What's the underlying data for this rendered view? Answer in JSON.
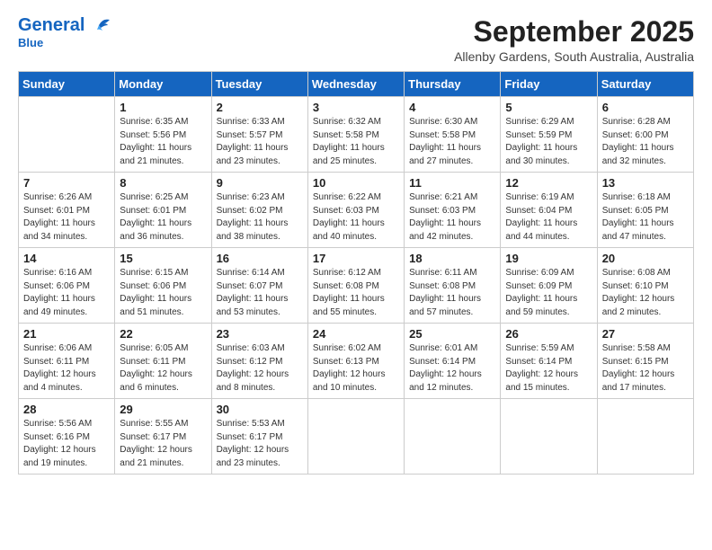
{
  "header": {
    "logo_general": "General",
    "logo_blue": "Blue",
    "month": "September 2025",
    "location": "Allenby Gardens, South Australia, Australia"
  },
  "weekdays": [
    "Sunday",
    "Monday",
    "Tuesday",
    "Wednesday",
    "Thursday",
    "Friday",
    "Saturday"
  ],
  "weeks": [
    [
      {
        "day": "",
        "info": ""
      },
      {
        "day": "1",
        "info": "Sunrise: 6:35 AM\nSunset: 5:56 PM\nDaylight: 11 hours\nand 21 minutes."
      },
      {
        "day": "2",
        "info": "Sunrise: 6:33 AM\nSunset: 5:57 PM\nDaylight: 11 hours\nand 23 minutes."
      },
      {
        "day": "3",
        "info": "Sunrise: 6:32 AM\nSunset: 5:58 PM\nDaylight: 11 hours\nand 25 minutes."
      },
      {
        "day": "4",
        "info": "Sunrise: 6:30 AM\nSunset: 5:58 PM\nDaylight: 11 hours\nand 27 minutes."
      },
      {
        "day": "5",
        "info": "Sunrise: 6:29 AM\nSunset: 5:59 PM\nDaylight: 11 hours\nand 30 minutes."
      },
      {
        "day": "6",
        "info": "Sunrise: 6:28 AM\nSunset: 6:00 PM\nDaylight: 11 hours\nand 32 minutes."
      }
    ],
    [
      {
        "day": "7",
        "info": "Sunrise: 6:26 AM\nSunset: 6:01 PM\nDaylight: 11 hours\nand 34 minutes."
      },
      {
        "day": "8",
        "info": "Sunrise: 6:25 AM\nSunset: 6:01 PM\nDaylight: 11 hours\nand 36 minutes."
      },
      {
        "day": "9",
        "info": "Sunrise: 6:23 AM\nSunset: 6:02 PM\nDaylight: 11 hours\nand 38 minutes."
      },
      {
        "day": "10",
        "info": "Sunrise: 6:22 AM\nSunset: 6:03 PM\nDaylight: 11 hours\nand 40 minutes."
      },
      {
        "day": "11",
        "info": "Sunrise: 6:21 AM\nSunset: 6:03 PM\nDaylight: 11 hours\nand 42 minutes."
      },
      {
        "day": "12",
        "info": "Sunrise: 6:19 AM\nSunset: 6:04 PM\nDaylight: 11 hours\nand 44 minutes."
      },
      {
        "day": "13",
        "info": "Sunrise: 6:18 AM\nSunset: 6:05 PM\nDaylight: 11 hours\nand 47 minutes."
      }
    ],
    [
      {
        "day": "14",
        "info": "Sunrise: 6:16 AM\nSunset: 6:06 PM\nDaylight: 11 hours\nand 49 minutes."
      },
      {
        "day": "15",
        "info": "Sunrise: 6:15 AM\nSunset: 6:06 PM\nDaylight: 11 hours\nand 51 minutes."
      },
      {
        "day": "16",
        "info": "Sunrise: 6:14 AM\nSunset: 6:07 PM\nDaylight: 11 hours\nand 53 minutes."
      },
      {
        "day": "17",
        "info": "Sunrise: 6:12 AM\nSunset: 6:08 PM\nDaylight: 11 hours\nand 55 minutes."
      },
      {
        "day": "18",
        "info": "Sunrise: 6:11 AM\nSunset: 6:08 PM\nDaylight: 11 hours\nand 57 minutes."
      },
      {
        "day": "19",
        "info": "Sunrise: 6:09 AM\nSunset: 6:09 PM\nDaylight: 11 hours\nand 59 minutes."
      },
      {
        "day": "20",
        "info": "Sunrise: 6:08 AM\nSunset: 6:10 PM\nDaylight: 12 hours\nand 2 minutes."
      }
    ],
    [
      {
        "day": "21",
        "info": "Sunrise: 6:06 AM\nSunset: 6:11 PM\nDaylight: 12 hours\nand 4 minutes."
      },
      {
        "day": "22",
        "info": "Sunrise: 6:05 AM\nSunset: 6:11 PM\nDaylight: 12 hours\nand 6 minutes."
      },
      {
        "day": "23",
        "info": "Sunrise: 6:03 AM\nSunset: 6:12 PM\nDaylight: 12 hours\nand 8 minutes."
      },
      {
        "day": "24",
        "info": "Sunrise: 6:02 AM\nSunset: 6:13 PM\nDaylight: 12 hours\nand 10 minutes."
      },
      {
        "day": "25",
        "info": "Sunrise: 6:01 AM\nSunset: 6:14 PM\nDaylight: 12 hours\nand 12 minutes."
      },
      {
        "day": "26",
        "info": "Sunrise: 5:59 AM\nSunset: 6:14 PM\nDaylight: 12 hours\nand 15 minutes."
      },
      {
        "day": "27",
        "info": "Sunrise: 5:58 AM\nSunset: 6:15 PM\nDaylight: 12 hours\nand 17 minutes."
      }
    ],
    [
      {
        "day": "28",
        "info": "Sunrise: 5:56 AM\nSunset: 6:16 PM\nDaylight: 12 hours\nand 19 minutes."
      },
      {
        "day": "29",
        "info": "Sunrise: 5:55 AM\nSunset: 6:17 PM\nDaylight: 12 hours\nand 21 minutes."
      },
      {
        "day": "30",
        "info": "Sunrise: 5:53 AM\nSunset: 6:17 PM\nDaylight: 12 hours\nand 23 minutes."
      },
      {
        "day": "",
        "info": ""
      },
      {
        "day": "",
        "info": ""
      },
      {
        "day": "",
        "info": ""
      },
      {
        "day": "",
        "info": ""
      }
    ]
  ]
}
